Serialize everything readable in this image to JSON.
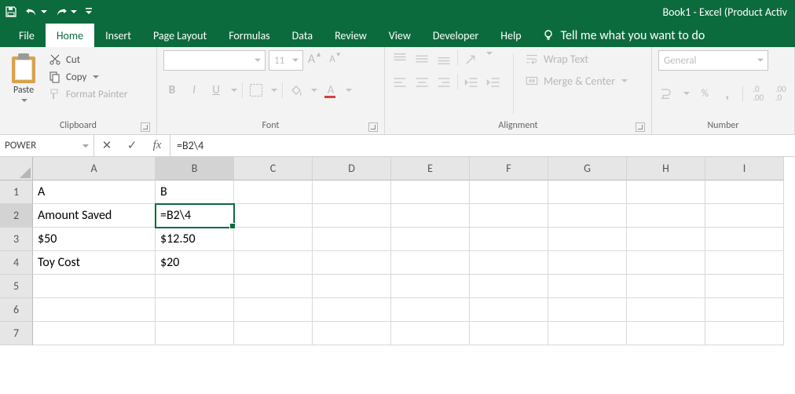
{
  "titlebar": {
    "title": "Book1  -  Excel (Product Activ"
  },
  "qat": {
    "save": "save-icon",
    "undo": "undo-icon",
    "redo": "redo-icon",
    "customize": "customize-icon"
  },
  "tabs": [
    "File",
    "Home",
    "Insert",
    "Page Layout",
    "Formulas",
    "Data",
    "Review",
    "View",
    "Developer",
    "Help"
  ],
  "active_tab": "Home",
  "tellme": {
    "placeholder": "Tell me what you want to do"
  },
  "ribbon": {
    "clipboard": {
      "label": "Clipboard",
      "paste": "Paste",
      "cut": "Cut",
      "copy": "Copy",
      "format_painter": "Format Painter"
    },
    "font": {
      "label": "Font",
      "font_name": "",
      "font_size": "11",
      "increase": "A",
      "decrease": "A",
      "bold": "B",
      "italic": "I",
      "underline": "U",
      "fontcolor": "A"
    },
    "alignment": {
      "label": "Alignment",
      "wrap": "Wrap Text",
      "merge": "Merge & Center"
    },
    "number": {
      "label": "Number",
      "format": "General",
      "percent": "%",
      "comma": ","
    }
  },
  "namebox": "POWER",
  "formula_bar": "=B2\\4",
  "columns": [
    "A",
    "B",
    "C",
    "D",
    "E",
    "F",
    "G",
    "H",
    "I"
  ],
  "rows": [
    "1",
    "2",
    "3",
    "4",
    "5",
    "6",
    "7"
  ],
  "active_cell": {
    "row": 2,
    "col": "B"
  },
  "cells": {
    "A1": "A",
    "B1": "B",
    "A2": "Amount Saved",
    "B2": "=B2\\4",
    "A3": "$50",
    "B3": "$12.50",
    "A4": "Toy Cost",
    "B4": "$20"
  }
}
